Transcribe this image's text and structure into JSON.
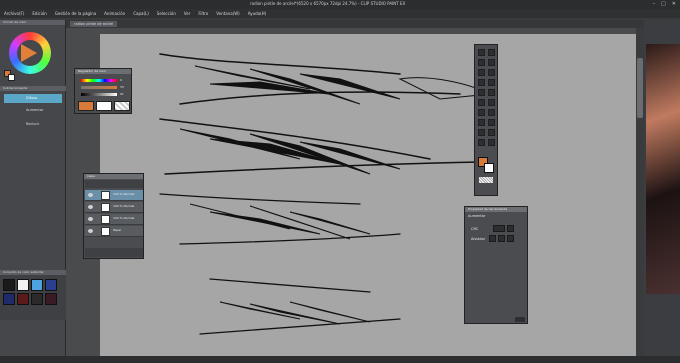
{
  "window": {
    "title": "radion pintle de arcilel*(6520 x 6570px 72dpi 24.7%) - CLIP STUDIO PAINT EX",
    "controls": [
      "–",
      "□",
      "✕"
    ]
  },
  "menu": [
    "Archivo(F)",
    "Edición",
    "Gestión de la página",
    "Animación",
    "Capa(L)",
    "Selección",
    "Ver",
    "Filtro",
    "Ventana(W)",
    "Ayuda(H)"
  ],
  "left_dock": {
    "color_wheel_header": "Círculo de color",
    "subtool_header": "Subherramienta",
    "subtools": [
      {
        "label": "Difuso",
        "selected": true
      },
      {
        "label": "Aumentar",
        "selected": false
      },
      {
        "label": "Reducir",
        "selected": false
      }
    ],
    "color_set_header": "Conjunto de color estándar",
    "color_swatches": [
      "#1a1a1a",
      "#f2f2f2",
      "#4da3e0",
      "#2a3f8f",
      "#1f2a6a",
      "#5a1a1a",
      "#2a2a2a",
      "#3a1a24"
    ]
  },
  "document_tab": {
    "label": "radion pintle de arcilel"
  },
  "color_slider_panel": {
    "header": "Regulador de color",
    "values": [
      "0",
      "33",
      "91"
    ],
    "main_color": "#d87a3a",
    "sub_color": "#ffffff"
  },
  "layer_panel": {
    "header": "Capa",
    "layers": [
      {
        "name": "100 % Normal",
        "sub": "Capa 2 Normal",
        "selected": true
      },
      {
        "name": "100 % Normal",
        "sub": "Capa 1",
        "selected": false
      },
      {
        "name": "100 % Normal",
        "sub": "Capa 1",
        "selected": false
      },
      {
        "name": "Papel",
        "sub": "",
        "selected": false
      }
    ]
  },
  "tool_palette": {
    "main_color": "#d87a3a",
    "sub_color": "#ffffff"
  },
  "tool_property_panel": {
    "header": "Propiedad de herramienta",
    "subheader": "Aumentar",
    "row1_label": "CRC",
    "row2_label": "Aislador"
  },
  "status_bar": {
    "text": ""
  }
}
